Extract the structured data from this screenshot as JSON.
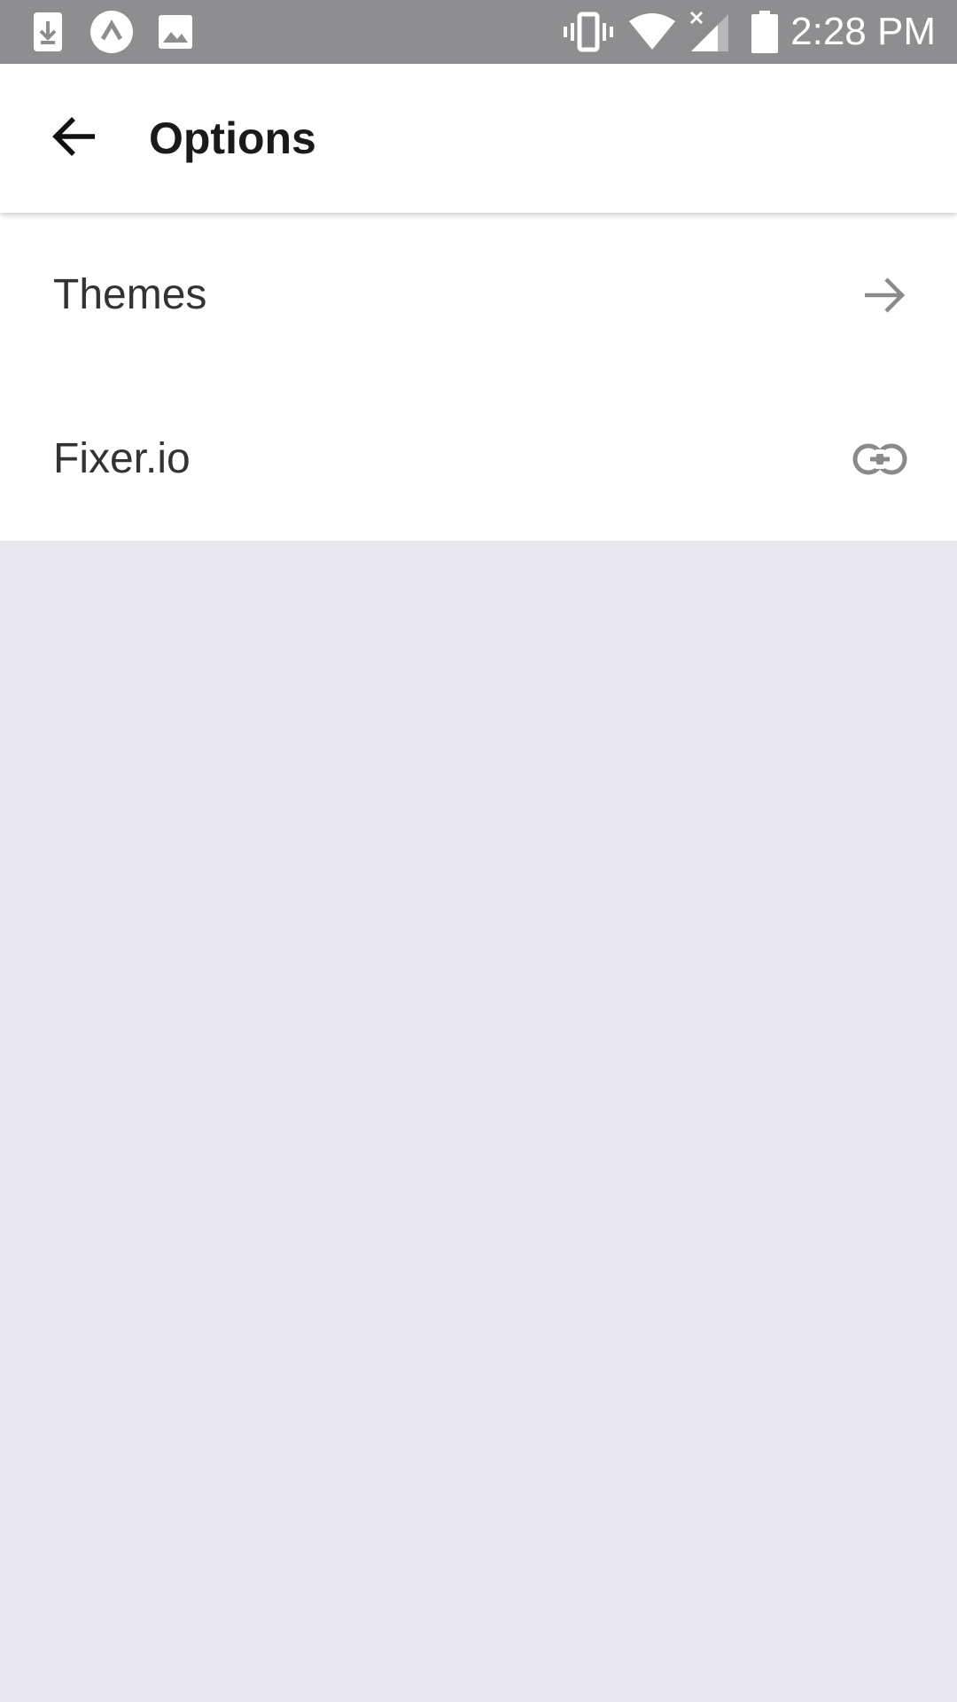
{
  "status_bar": {
    "time": "2:28 PM",
    "left_icons": [
      "download-notification-icon",
      "app-notification-icon",
      "image-notification-icon"
    ],
    "right_icons": [
      "vibrate-icon",
      "wifi-icon",
      "cell-signal-icon",
      "battery-icon"
    ],
    "background": "#8e8e90"
  },
  "toolbar": {
    "title": "Options",
    "back_icon": "arrow-left-icon"
  },
  "options": [
    {
      "label": "Themes",
      "icon": "arrow-right-icon"
    },
    {
      "label": "Fixer.io",
      "icon": "link-icon"
    }
  ],
  "colors": {
    "page_background": "#e9e8ee",
    "surface": "#ffffff",
    "text": "#333333",
    "icon_muted": "#8a8a8a"
  }
}
